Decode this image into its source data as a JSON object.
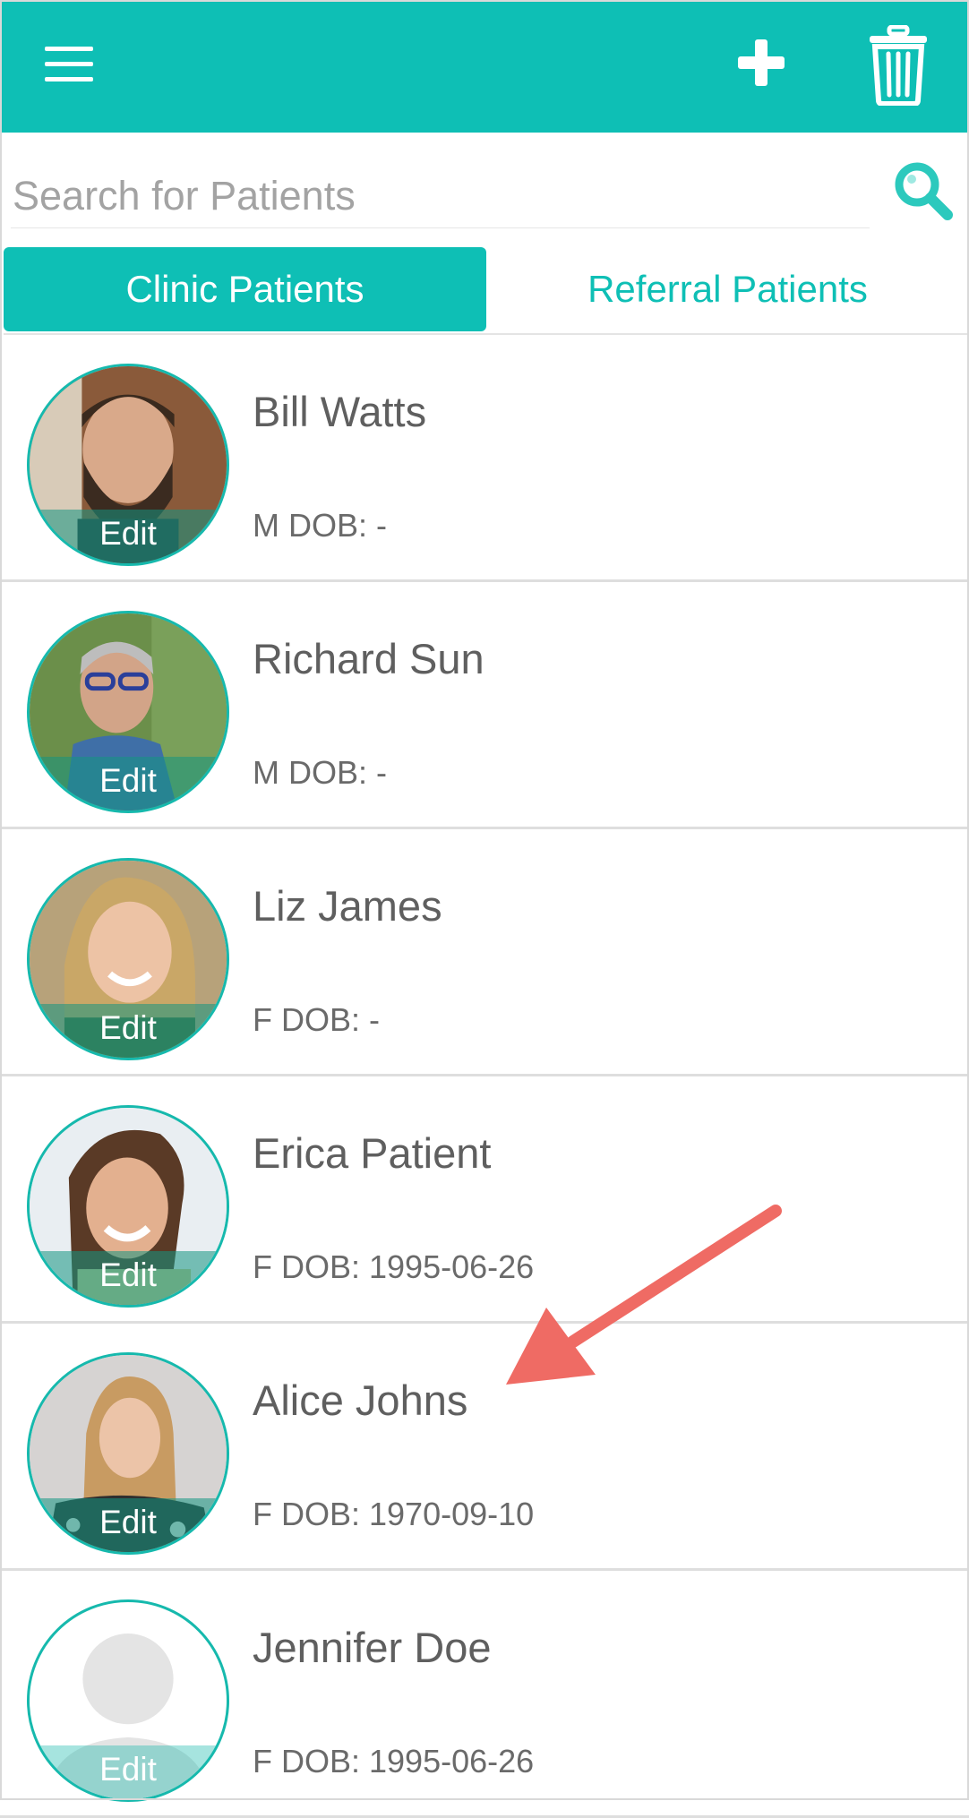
{
  "header": {
    "menu_icon": "hamburger-menu-icon",
    "add_icon": "plus-icon",
    "delete_icon": "trash-icon",
    "bg_color": "#0ebfb5"
  },
  "search": {
    "placeholder": "Search for Patients",
    "value": "",
    "icon": "search-icon"
  },
  "tabs": [
    {
      "label": "Clinic Patients",
      "active": true
    },
    {
      "label": "Referral Patients",
      "active": false
    }
  ],
  "patients": [
    {
      "name": "Bill Watts",
      "meta": "M DOB: -",
      "edit": "Edit"
    },
    {
      "name": "Richard Sun",
      "meta": "M DOB: -",
      "edit": "Edit"
    },
    {
      "name": "Liz James",
      "meta": "F DOB: -",
      "edit": "Edit"
    },
    {
      "name": "Erica Patient",
      "meta": "F DOB: 1995-06-26",
      "edit": "Edit"
    },
    {
      "name": "Alice Johns",
      "meta": "F DOB: 1970-09-10",
      "edit": "Edit"
    },
    {
      "name": "Jennifer Doe",
      "meta": "F DOB: 1995-06-26",
      "edit": "Edit"
    }
  ],
  "annotation": {
    "type": "arrow",
    "color": "#ef6b64"
  }
}
